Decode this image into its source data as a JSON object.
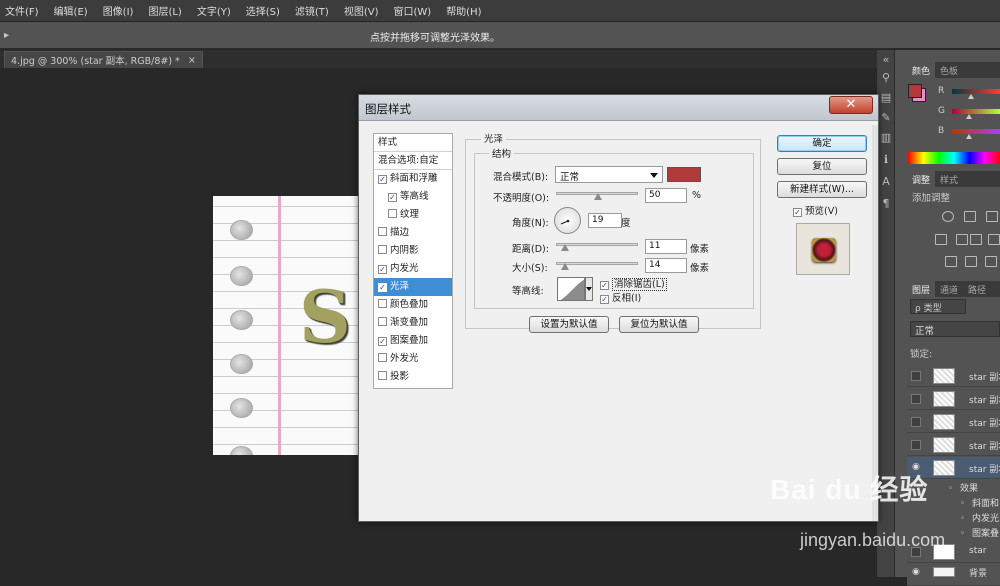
{
  "menubar": {
    "items": [
      "文件(F)",
      "编辑(E)",
      "图像(I)",
      "图层(L)",
      "文字(Y)",
      "选择(S)",
      "滤镜(T)",
      "视图(V)",
      "窗口(W)",
      "帮助(H)"
    ]
  },
  "options_bar": {
    "hint": "点按并拖移可调整光泽效果。"
  },
  "document_tab": {
    "title": "4.jpg @ 300% (star 副本, RGB/8#) *",
    "close": "×"
  },
  "canvas": {
    "letter": "S"
  },
  "color_panel": {
    "tabs": [
      "颜色",
      "色板"
    ],
    "labels": [
      "R",
      "G",
      "B"
    ],
    "foreground": "#b03a3a",
    "background": "#e38fd0"
  },
  "adjustments_panel": {
    "tabs": [
      "调整",
      "样式"
    ],
    "title": "添加调整"
  },
  "layers_panel": {
    "tabs": [
      "图层",
      "通道",
      "路径"
    ],
    "filter": "ρ 类型",
    "blend_mode": "正常",
    "lock_label": "锁定:",
    "layers": [
      {
        "name": "star 副本",
        "selected": false
      },
      {
        "name": "star 副本",
        "selected": false
      },
      {
        "name": "star 副本",
        "selected": false
      },
      {
        "name": "star 副本",
        "selected": false
      },
      {
        "name": "star 副本",
        "selected": true
      }
    ],
    "effects_label": "效果",
    "effects": [
      "斜面和",
      "内发光",
      "图案叠"
    ],
    "bottom_layers": [
      "star",
      "背景"
    ]
  },
  "dialog": {
    "title": "图层样式",
    "close": "✕",
    "style_list": {
      "header": "样式",
      "blend_options": "混合选项:自定",
      "items": [
        {
          "label": "斜面和浮雕",
          "checked": true,
          "indent": false,
          "selected": false
        },
        {
          "label": "等高线",
          "checked": true,
          "indent": true,
          "selected": false
        },
        {
          "label": "纹理",
          "checked": false,
          "indent": true,
          "selected": false
        },
        {
          "label": "描边",
          "checked": false,
          "indent": false,
          "selected": false
        },
        {
          "label": "内阴影",
          "checked": false,
          "indent": false,
          "selected": false
        },
        {
          "label": "内发光",
          "checked": true,
          "indent": false,
          "selected": false
        },
        {
          "label": "光泽",
          "checked": true,
          "indent": false,
          "selected": true
        },
        {
          "label": "颜色叠加",
          "checked": false,
          "indent": false,
          "selected": false
        },
        {
          "label": "渐变叠加",
          "checked": false,
          "indent": false,
          "selected": false
        },
        {
          "label": "图案叠加",
          "checked": true,
          "indent": false,
          "selected": false
        },
        {
          "label": "外发光",
          "checked": false,
          "indent": false,
          "selected": false
        },
        {
          "label": "投影",
          "checked": false,
          "indent": false,
          "selected": false
        }
      ]
    },
    "satin": {
      "group_title": "光泽",
      "structure_title": "结构",
      "blend_mode_label": "混合模式(B):",
      "blend_mode_value": "正常",
      "color": "#b03a3a",
      "opacity_label": "不透明度(O):",
      "opacity_value": "50",
      "opacity_unit": "%",
      "angle_label": "角度(N):",
      "angle_value": "19",
      "angle_unit": "度",
      "distance_label": "距离(D):",
      "distance_value": "11",
      "distance_unit": "像素",
      "size_label": "大小(S):",
      "size_value": "14",
      "size_unit": "像素",
      "contour_label": "等高线:",
      "antialias_label": "消除锯齿(L)",
      "antialias_checked": true,
      "invert_label": "反相(I)",
      "invert_checked": true,
      "make_default": "设置为默认值",
      "reset_default": "复位为默认值"
    },
    "buttons": {
      "ok": "确定",
      "reset": "复位",
      "new_style": "新建样式(W)...",
      "preview_label": "预览(V)",
      "preview_checked": true
    }
  },
  "watermark": {
    "brand": "Bai du 经验",
    "url": "jingyan.baidu.com"
  }
}
